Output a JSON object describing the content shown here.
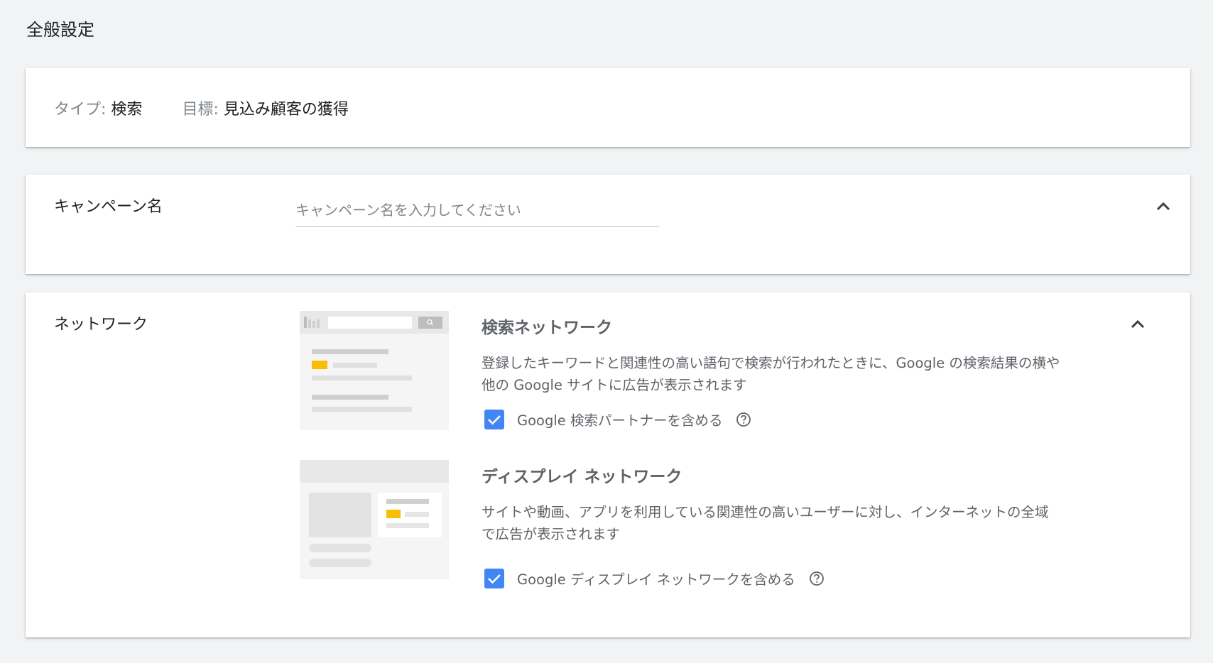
{
  "page": {
    "title": "全般設定"
  },
  "summary": {
    "type_key": "タイプ:",
    "type_value": "検索",
    "goal_key": "目標:",
    "goal_value": "見込み顧客の獲得"
  },
  "campaign": {
    "label": "キャンペーン名",
    "input_value": "",
    "input_placeholder": "キャンペーン名を入力してください"
  },
  "network": {
    "label": "ネットワーク",
    "search": {
      "title": "検索ネットワーク",
      "desc_line1": "登録したキーワードと関連性の高い語句で検索が行われたときに、Google の検索結果の横や",
      "desc_line2": "他の Google サイトに広告が表示されます",
      "checkbox_label": "Google 検索パートナーを含める",
      "checked": true
    },
    "display": {
      "title": "ディスプレイ ネットワーク",
      "desc_line1": "サイトや動画、アプリを利用している関連性の高いユーザーに対し、インターネットの全域",
      "desc_line2": "で広告が表示されます",
      "checkbox_label": "Google ディスプレイ ネットワークを含める",
      "checked": true
    }
  },
  "icons": {
    "chevron": "chevron-up-icon",
    "check": "check-icon",
    "help": "help-circle-icon"
  },
  "colors": {
    "accent": "#4285f4",
    "ad_highlight": "#fbbc04",
    "background": "#f1f3f4"
  }
}
